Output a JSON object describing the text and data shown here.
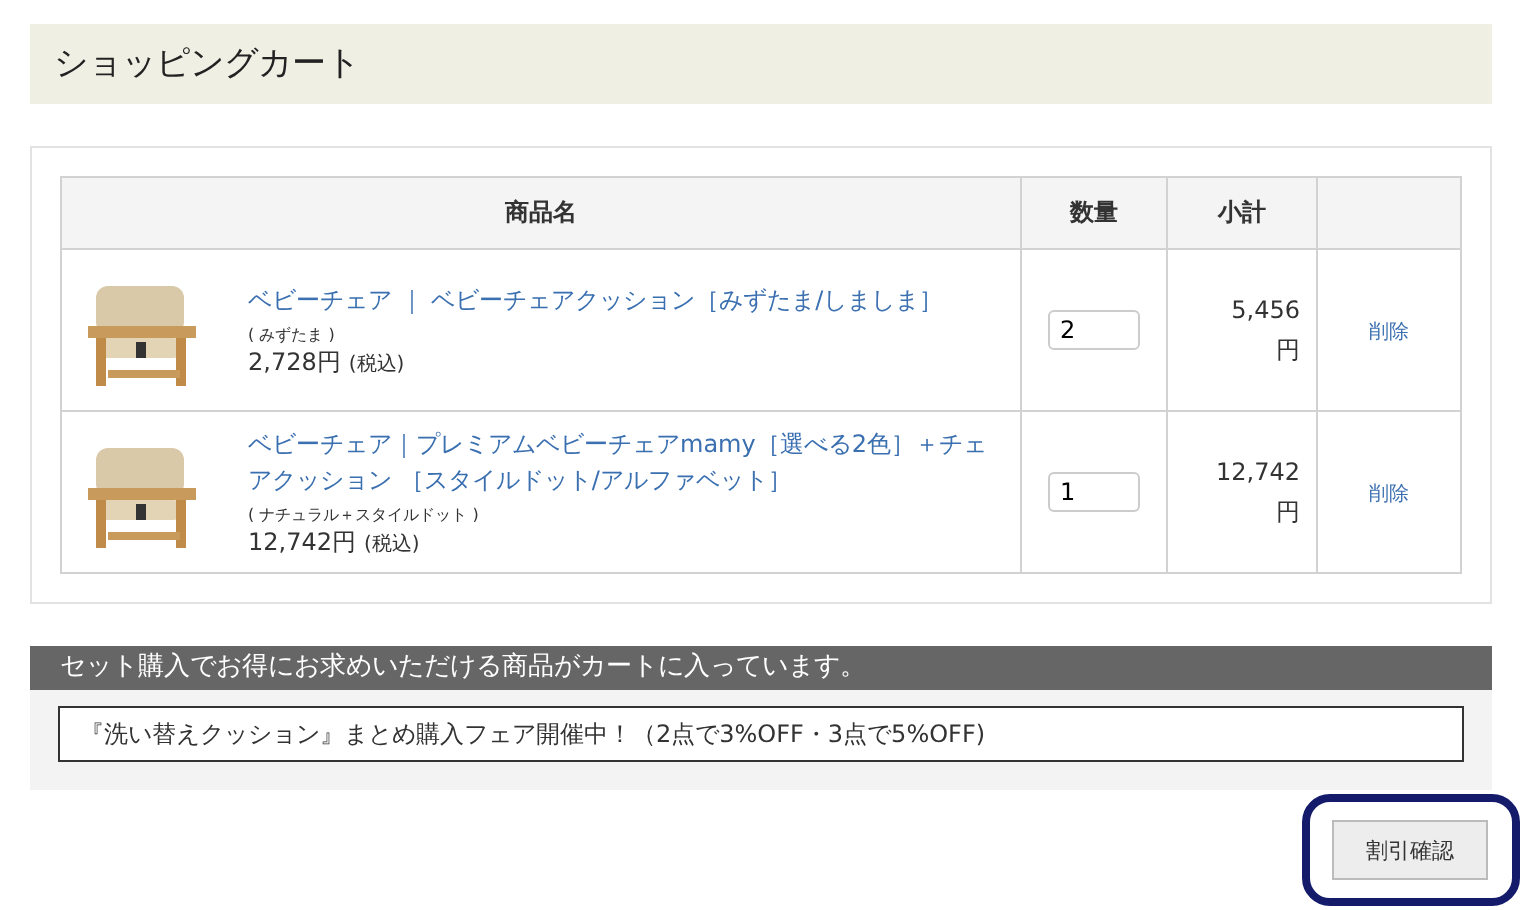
{
  "page_title": "ショッピングカート",
  "table": {
    "columns": [
      "商品名",
      "数量",
      "小計",
      ""
    ],
    "rows": [
      {
        "name": "ベビーチェア ｜ ベビーチェアクッション［みずたま/しましま］",
        "option": "( みずたま )",
        "price": "2,728円",
        "tax": "(税込)",
        "quantity": "2",
        "subtotal": "5,456円",
        "delete": "削除"
      },
      {
        "name": "ベビーチェア｜プレミアムベビーチェアmamy［選べる2色］＋チェアクッション ［スタイルドット/アルファベット］",
        "option": "( ナチュラル＋スタイルドット )",
        "price": "12,742円",
        "tax": "(税込)",
        "quantity": "1",
        "subtotal": "12,742円",
        "delete": "削除"
      }
    ]
  },
  "set_section": {
    "heading": "セット購入でお得にお求めいただける商品がカートに入っています。",
    "notice": "『洗い替えクッション』まとめ購入フェア開催中！（2点で3%OFF・3点で5%OFF)"
  },
  "discount_button": {
    "label": "割引確認",
    "highlighted": true
  }
}
